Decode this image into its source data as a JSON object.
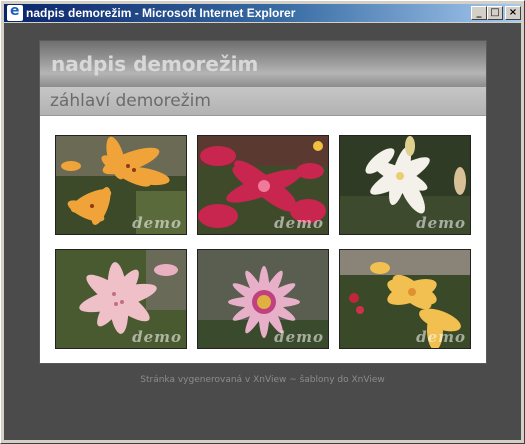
{
  "window": {
    "title": "nadpis demorežim - Microsoft Internet Explorer"
  },
  "controls": {
    "minimize": "_",
    "maximize": "□",
    "close": "×"
  },
  "page": {
    "heading": "nadpis demorežim",
    "subheading": "záhlaví demorežim",
    "footer": "Stránka vygenerovaná v XnView  ~  šablony do XnView",
    "thumbnails": [
      {
        "subject": "orange lily",
        "watermark": "demo"
      },
      {
        "subject": "pink lily",
        "watermark": "demo"
      },
      {
        "subject": "white lily",
        "watermark": "demo"
      },
      {
        "subject": "light pink lily",
        "watermark": "demo"
      },
      {
        "subject": "pink gazania",
        "watermark": "demo"
      },
      {
        "subject": "yellow daylily",
        "watermark": "demo"
      }
    ]
  },
  "colors": {
    "titlebar": "#0a246a",
    "background": "#4b4b4b",
    "panel": "#ffffff"
  }
}
